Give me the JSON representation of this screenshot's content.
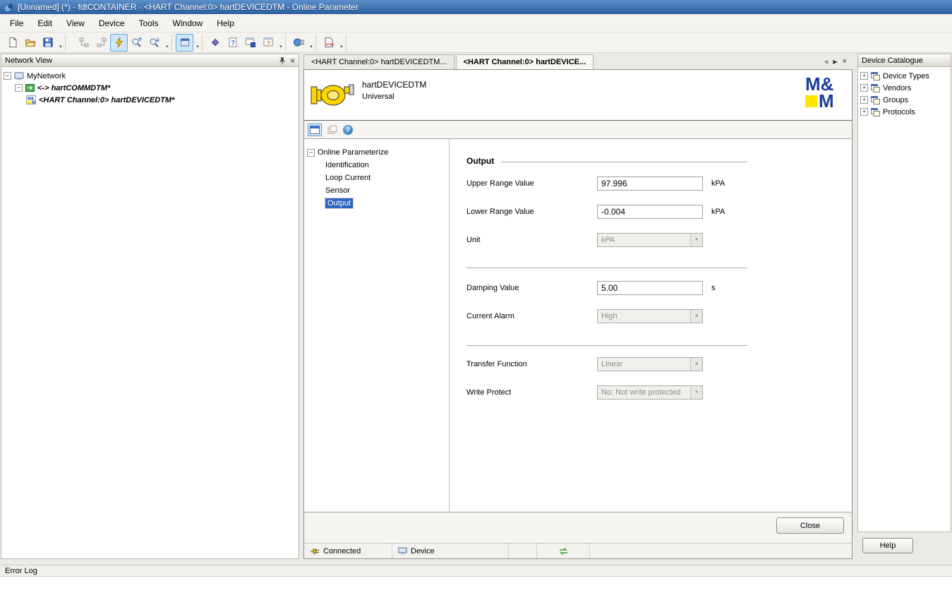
{
  "title_bar": {
    "title": "[Unnamed] (*)  - fdtCONTAINER - <HART Channel:0> hartDEVICEDTM - Online Parameter"
  },
  "menu_bar": {
    "items": [
      "File",
      "Edit",
      "View",
      "Device",
      "Tools",
      "Window",
      "Help"
    ]
  },
  "toolbar": {
    "icons": [
      "new-file-icon",
      "open-file-icon",
      "save-icon",
      "dropdown",
      "network-upload-icon",
      "network-download-icon",
      "connect-plug-icon",
      "load-from-device-icon",
      "store-to-device-icon",
      "dropdown",
      "device-catalog-icon",
      "dropdown",
      "diamond-icon",
      "help-icon",
      "report-icon",
      "about-icon",
      "dropdown",
      "connection-orb-icon",
      "dropdown",
      "html-export-icon",
      "dropdown"
    ]
  },
  "network_view": {
    "title": "Network View",
    "nodes": {
      "root": "MyNetwork",
      "comm": "<-> hartCOMMDTM*",
      "device": "<HART Channel:0> hartDEVICEDTM*"
    }
  },
  "tabs": {
    "items": [
      {
        "label": "<HART Channel:0> hartDEVICEDTM..."
      },
      {
        "label": "<HART Channel:0> hartDEVICE..."
      }
    ]
  },
  "device": {
    "name": "hartDEVICEDTM",
    "type": "Universal",
    "logo_line1": "M&",
    "logo_line2": "M"
  },
  "param_tree": {
    "root": "Online Parameterize",
    "items": [
      "Identification",
      "Loop Current",
      "Sensor",
      "Output"
    ],
    "selected": "Output"
  },
  "form": {
    "section": "Output",
    "fields": [
      {
        "label": "Upper Range Value",
        "value": "97.996",
        "unit": "kPA"
      },
      {
        "label": "Lower Range Value",
        "value": "-0.004",
        "unit": "kPA"
      },
      {
        "label": "Unit",
        "value": "kPA",
        "unit": ""
      },
      {
        "label": "Damping Value",
        "value": "5.00",
        "unit": "s"
      },
      {
        "label": "Current Alarm",
        "value": "High",
        "unit": ""
      },
      {
        "label": "Transfer Function",
        "value": "Linear",
        "unit": ""
      },
      {
        "label": "Write Protect",
        "value": "No: Not write protected",
        "unit": ""
      }
    ],
    "close_label": "Close"
  },
  "status_bar": {
    "connected": "Connected",
    "device": "Device"
  },
  "device_catalogue": {
    "title": "Device Catalogue",
    "items": [
      "Device Types",
      "Vendors",
      "Groups",
      "Protocols"
    ],
    "help_label": "Help"
  },
  "error_log": {
    "title": "Error Log"
  },
  "glyphs": {
    "close": "×",
    "dropdown": "▾",
    "tab_prev": "◀",
    "tab_next": "▶",
    "collapse": "−",
    "expand": "+",
    "combo_arrow": "▼",
    "question": "?"
  }
}
